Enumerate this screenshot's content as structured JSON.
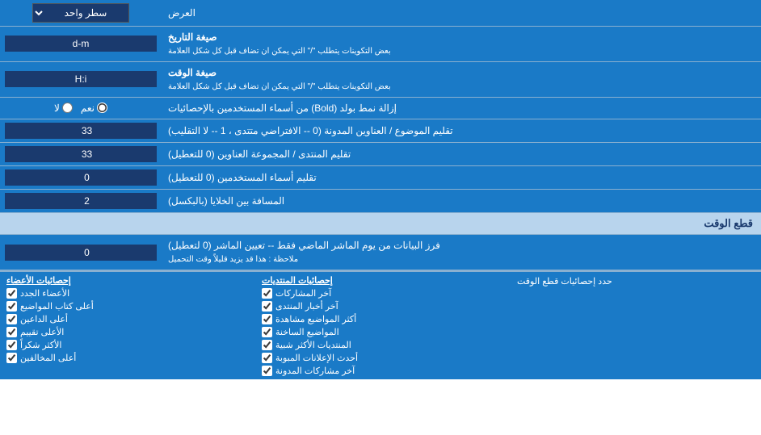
{
  "title": "العرض",
  "rows": [
    {
      "label": "العرض",
      "input_type": "dropdown",
      "input_value": "سطر واحد"
    },
    {
      "label": "صيغة التاريخ\nبعض التكوينات يتطلب \"/\" التي يمكن ان تضاف قبل كل شكل العلامة",
      "input_type": "text",
      "input_value": "d-m"
    },
    {
      "label": "صيغة الوقت\nبعض التكوينات يتطلب \"/\" التي يمكن ان تضاف قبل كل شكل العلامة",
      "input_type": "text",
      "input_value": "H:i"
    },
    {
      "label": "إزالة نمط بولد (Bold) من أسماء المستخدمين بالإحصائيات",
      "input_type": "radio",
      "options": [
        "نعم",
        "لا"
      ],
      "selected": "نعم"
    },
    {
      "label": "تقليم الموضوع / العناوين المدونة (0 -- الافتراضي متتدى ، 1 -- لا التقليب)",
      "input_type": "number",
      "input_value": "33"
    },
    {
      "label": "تقليم المنتدى / المجموعة العناوين (0 للتعطيل)",
      "input_type": "number",
      "input_value": "33"
    },
    {
      "label": "تقليم أسماء المستخدمين (0 للتعطيل)",
      "input_type": "number",
      "input_value": "0"
    },
    {
      "label": "المسافة بين الخلايا (بالبكسل)",
      "input_type": "number",
      "input_value": "2"
    }
  ],
  "section_cutoff": {
    "title": "قطع الوقت",
    "row": {
      "label": "فرز البيانات من يوم الماشر الماضي فقط -- تعيين الماشر (0 لتعطيل)\nملاحظة : هذا قد يزيد قليلاً وقت التحميل",
      "input_value": "0"
    },
    "cutoff_label": "حدد إحصائيات قطع الوقت"
  },
  "checkboxes": {
    "col1_title": "إحصائيات المنتديات",
    "col1_items": [
      "آخر المشاركات",
      "آخر أخبار المنتدى",
      "أكثر المواضيع مشاهدة",
      "المواضيع الساخنة",
      "المنتديات الأكثر شبية",
      "أحدث الإعلانات المبوبة",
      "آخر مشاركات المدونة"
    ],
    "col2_title": "إحصائيات الأعضاء",
    "col2_items": [
      "الأعضاء الجدد",
      "أعلى كتاب المواضيع",
      "أعلى الداعين",
      "الأعلى تقييم",
      "الأكثر شكراً",
      "أعلى المخالفين"
    ]
  }
}
